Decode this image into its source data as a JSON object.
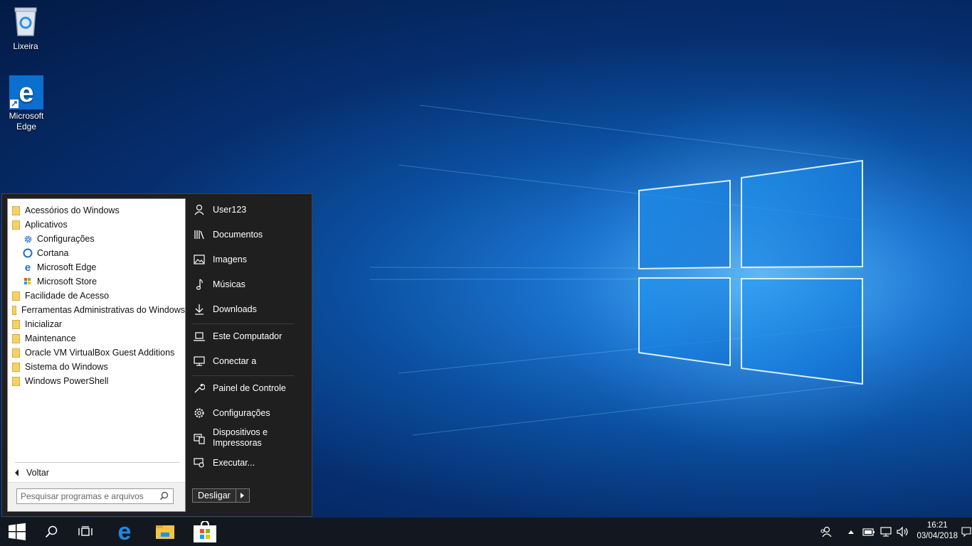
{
  "desktop": {
    "icons": [
      {
        "label": "Lixeira"
      },
      {
        "label": "Microsoft Edge"
      }
    ]
  },
  "start_menu": {
    "programs": [
      {
        "label": "Acessórios do Windows",
        "type": "folder",
        "icon": "folder-icon"
      },
      {
        "label": "Aplicativos",
        "type": "folder",
        "icon": "folder-icon"
      },
      {
        "label": "Configurações",
        "type": "app",
        "icon": "gear-icon"
      },
      {
        "label": "Cortana",
        "type": "app",
        "icon": "cortana-icon"
      },
      {
        "label": "Microsoft Edge",
        "type": "app",
        "icon": "edge-icon"
      },
      {
        "label": "Microsoft Store",
        "type": "app",
        "icon": "store-icon"
      },
      {
        "label": "Facilidade de Acesso",
        "type": "folder",
        "icon": "folder-icon"
      },
      {
        "label": "Ferramentas Administrativas do Windows",
        "type": "folder",
        "icon": "folder-icon"
      },
      {
        "label": "Inicializar",
        "type": "folder",
        "icon": "folder-icon"
      },
      {
        "label": "Maintenance",
        "type": "folder",
        "icon": "folder-icon"
      },
      {
        "label": "Oracle VM VirtualBox Guest Additions",
        "type": "folder",
        "icon": "folder-icon"
      },
      {
        "label": "Sistema do Windows",
        "type": "folder",
        "icon": "folder-icon"
      },
      {
        "label": "Windows PowerShell",
        "type": "folder",
        "icon": "folder-icon"
      }
    ],
    "back_label": "Voltar",
    "search_placeholder": "Pesquisar programas e arquivos",
    "right_items": [
      {
        "label": "User123",
        "icon": "user-icon"
      },
      {
        "label": "Documentos",
        "icon": "books-icon"
      },
      {
        "label": "Imagens",
        "icon": "image-icon"
      },
      {
        "label": "Músicas",
        "icon": "music-icon"
      },
      {
        "label": "Downloads",
        "icon": "download-icon"
      },
      {
        "label": "Este Computador",
        "icon": "laptop-icon"
      },
      {
        "label": "Conectar a",
        "icon": "network-monitor-icon"
      },
      {
        "label": "Painel de Controle",
        "icon": "wrench-icon"
      },
      {
        "label": "Configurações",
        "icon": "gear-icon"
      },
      {
        "label": "Dispositivos e",
        "label2": "Impressoras",
        "icon": "printer-icon"
      },
      {
        "label": "Executar...",
        "icon": "run-icon"
      }
    ],
    "shutdown_label": "Desligar"
  },
  "taskbar": {
    "time": "16:21",
    "date": "03/04/2018"
  },
  "colors": {
    "accent": "#0078d7",
    "taskbar": "#131820",
    "start_bg": "#1f1f1f"
  }
}
